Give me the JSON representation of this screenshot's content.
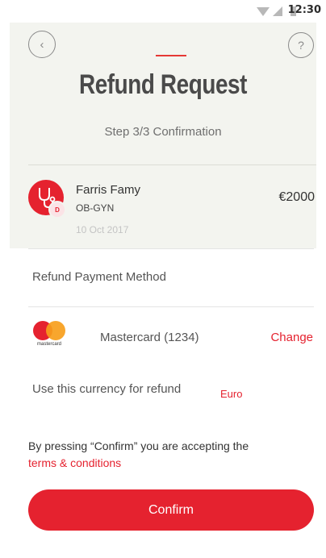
{
  "status_bar": {
    "time": "12:30"
  },
  "header": {
    "back_icon": "chevron-left-icon",
    "back_glyph": "‹",
    "help_icon": "question-icon",
    "help_glyph": "?",
    "title": "Refund Request",
    "step": "Step 3/3 Confirmation"
  },
  "doctor": {
    "name": "Farris Famy",
    "specialty": "OB-GYN",
    "badge": "D",
    "date": "10 Oct 2017",
    "amount": "€2000",
    "avatar_icon": "stethoscope-icon"
  },
  "payment": {
    "section_label": "Refund Payment Method",
    "card_brand_text": "mastercard",
    "card_label": "Mastercard (1234)",
    "change_label": "Change"
  },
  "currency": {
    "label": "Use this currency for refund",
    "value": "Euro"
  },
  "consent": {
    "text": "By pressing “Confirm” you are accepting the",
    "link": "terms & conditions"
  },
  "actions": {
    "confirm_label": "Confirm"
  },
  "colors": {
    "accent": "#e5222f",
    "header_bg": "#f3f4ef",
    "mastercard_orange": "#f79e1b"
  }
}
